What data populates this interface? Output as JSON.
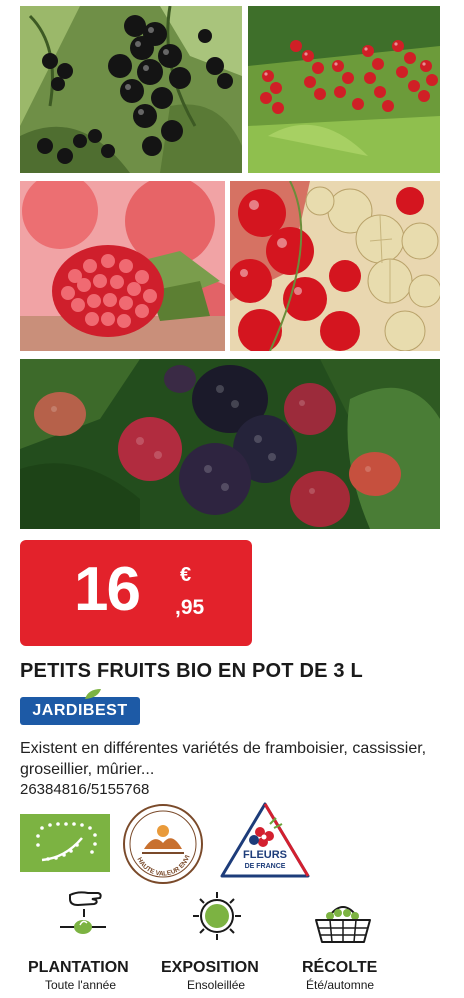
{
  "photos": [
    "blackcurrant-photo",
    "redcurrant-photo",
    "raspberry-photo",
    "gooseberry-photo",
    "blackberry-photo"
  ],
  "price": {
    "integer": "16",
    "currency": "€",
    "decimals": ",95",
    "color": "#e3222b"
  },
  "product": {
    "title": "PETITS FRUITS BIO EN POT DE 3 L",
    "brand": "JARDIBEST",
    "description": "Existent en différentes variétés de framboisier, cassissier, groseillier, mûrier...",
    "reference": "26384816/5155768"
  },
  "labels": {
    "bio_icon": "organic-leaf-icon",
    "hve_text": "HAUTE VALEUR ENVIRONNEMENTALE",
    "fleurs_title": "FLEURS",
    "fleurs_sub": "DE FRANCE"
  },
  "info": [
    {
      "title": "PLANTATION",
      "subtitle": "Toute l'année",
      "icon": "hand-planting-icon"
    },
    {
      "title": "EXPOSITION",
      "subtitle": "Ensoleillée",
      "icon": "sun-icon"
    },
    {
      "title": "RÉCOLTE",
      "subtitle": "Été/automne",
      "icon": "basket-icon"
    }
  ],
  "colors": {
    "brand_blue": "#1d5aa6",
    "bio_green": "#7cb342",
    "hve_brown": "#7a4a2a"
  }
}
